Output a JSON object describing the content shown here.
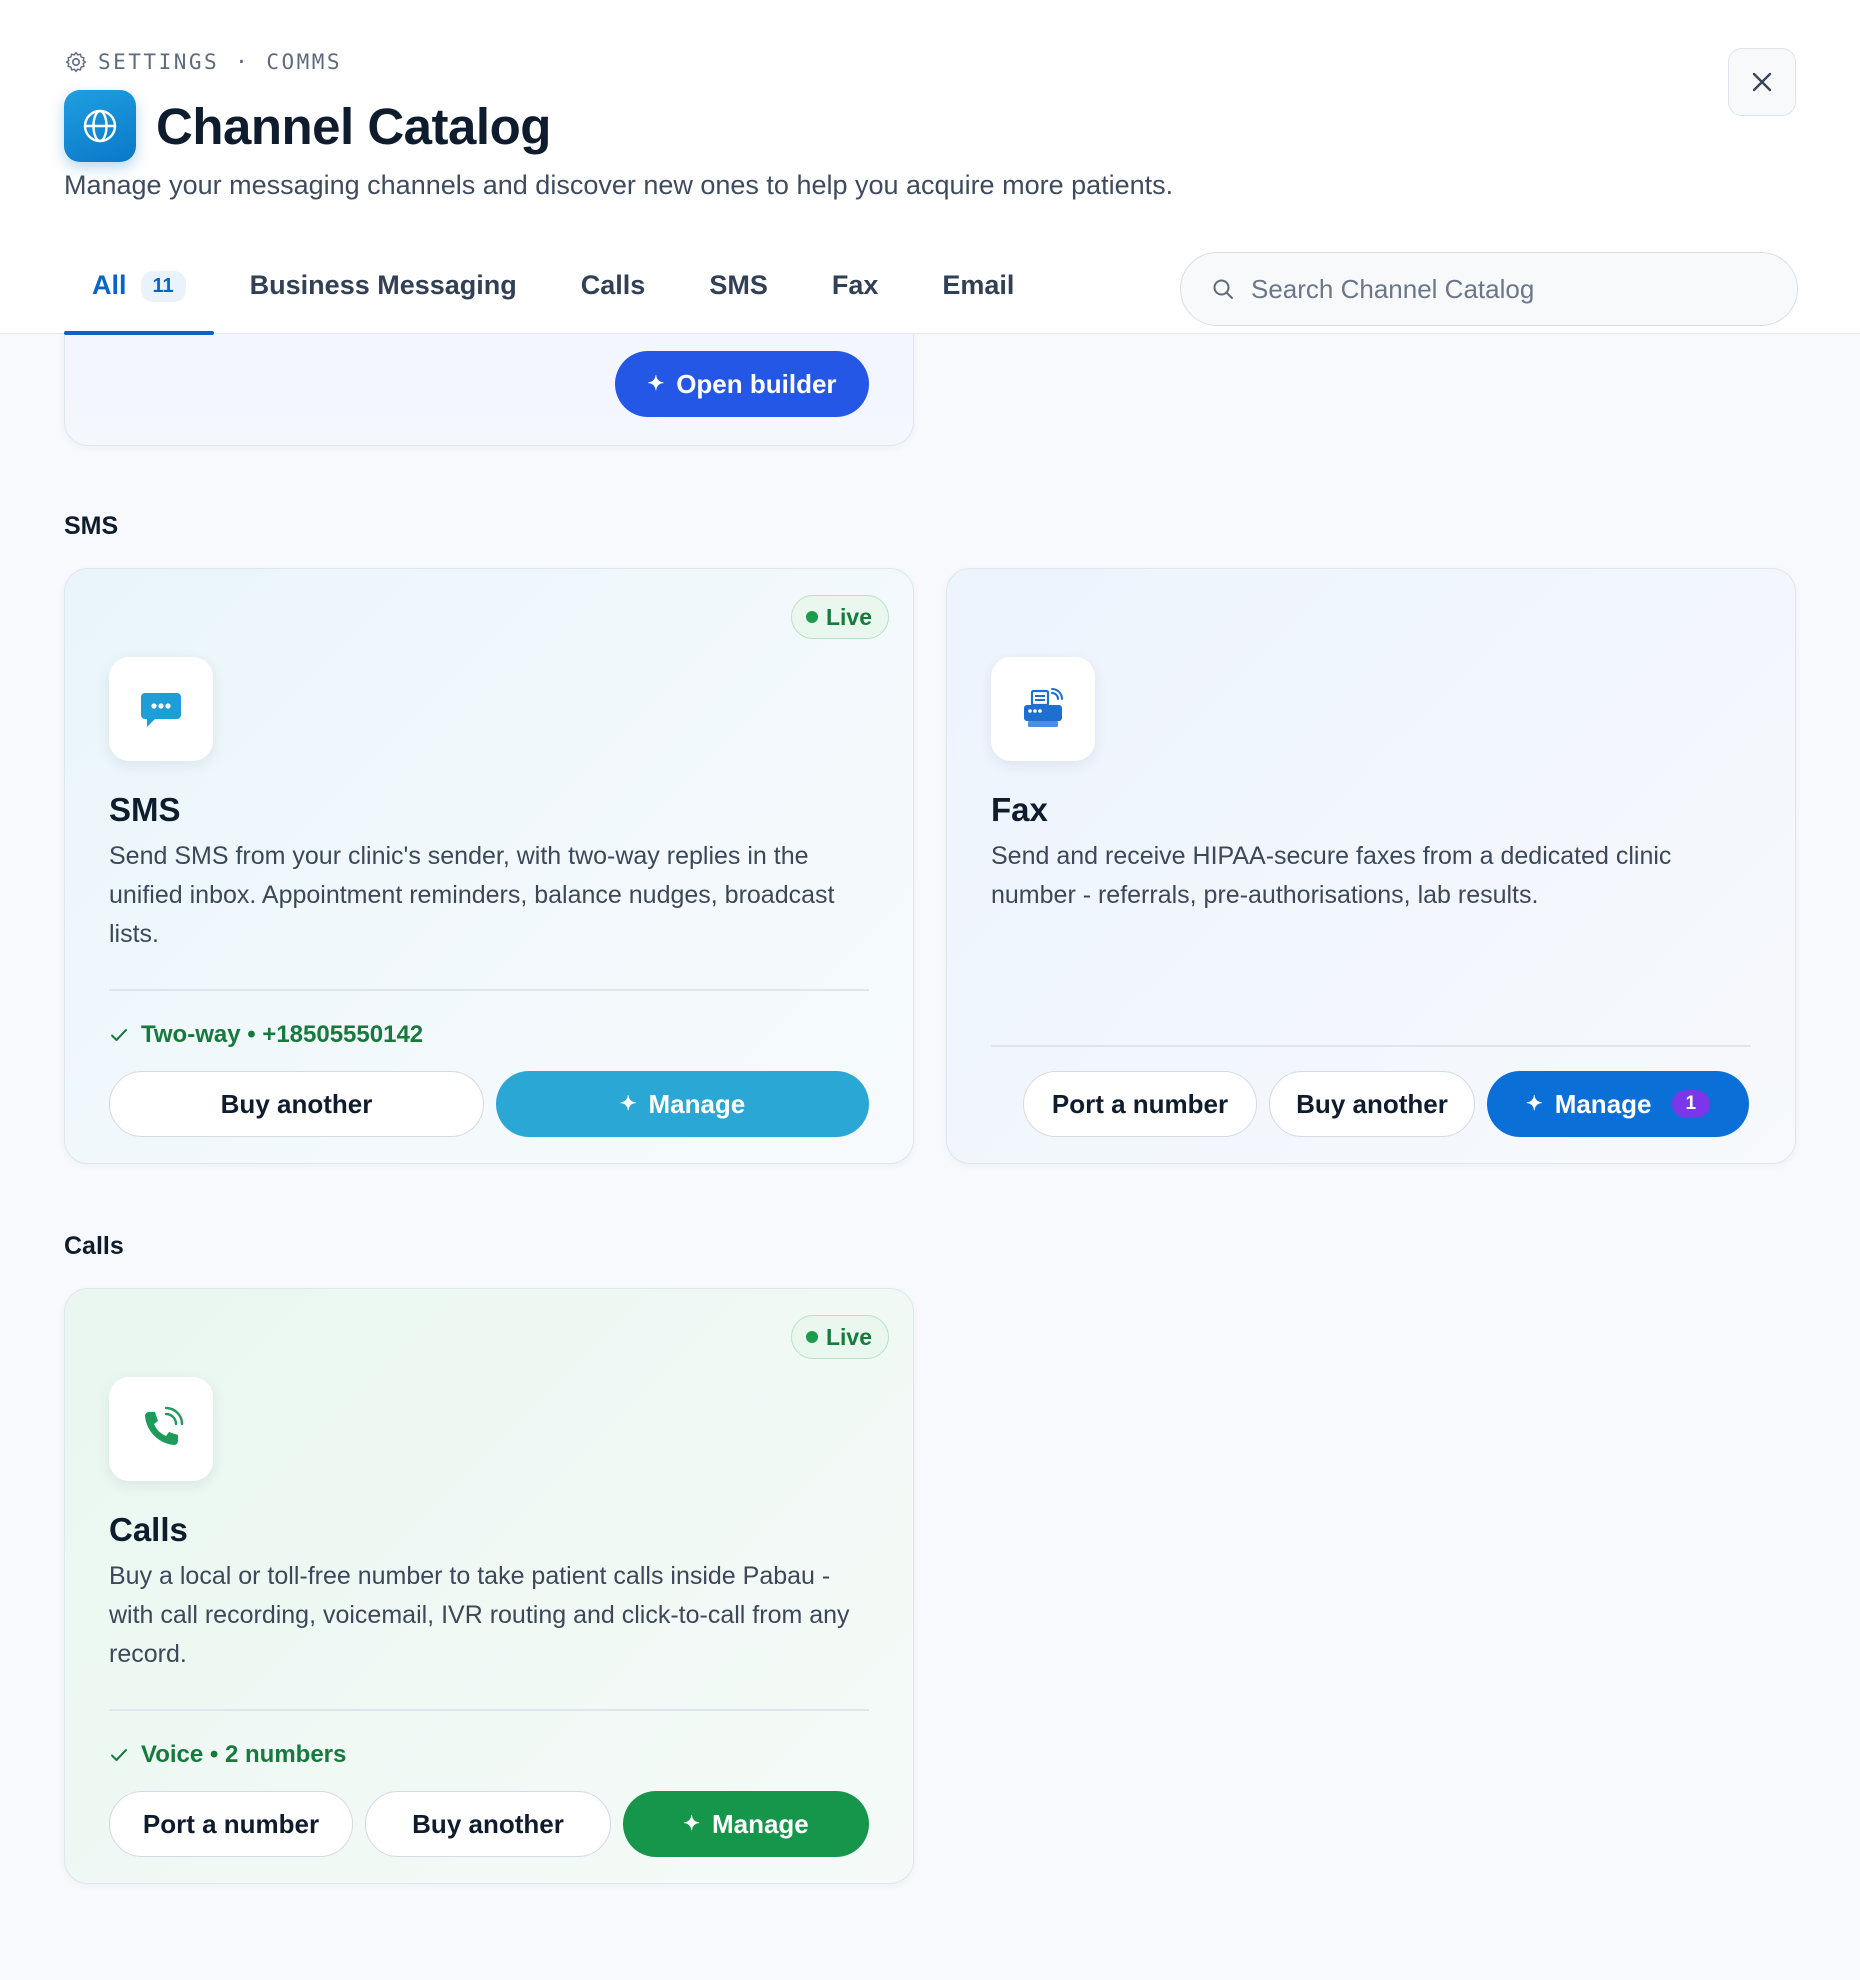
{
  "breadcrumb": {
    "settings": "SETTINGS",
    "separator": "·",
    "section": "COMMS"
  },
  "header": {
    "title": "Channel Catalog",
    "subtitle": "Manage your messaging channels and discover new ones to help you acquire more patients.",
    "icon": "globe-icon"
  },
  "tabs": [
    {
      "label": "All",
      "count": "11",
      "active": true
    },
    {
      "label": "Business Messaging"
    },
    {
      "label": "Calls"
    },
    {
      "label": "SMS"
    },
    {
      "label": "Fax"
    },
    {
      "label": "Email"
    }
  ],
  "search": {
    "placeholder": "Search Channel Catalog"
  },
  "builder_card": {
    "button_label": "Open builder",
    "button_color": "#2457e6"
  },
  "sections": {
    "sms": "SMS",
    "calls": "Calls"
  },
  "cards": {
    "sms": {
      "badge": "Live",
      "title": "SMS",
      "description": "Send SMS from your clinic's sender, with two-way replies in the unified inbox. Appointment reminders, balance nudges, broadcast lists.",
      "status": "Two-way • +18505550142",
      "buy_label": "Buy another",
      "manage_label": "Manage",
      "manage_color": "#2aa7d4",
      "icon": "chat-bubble-icon"
    },
    "fax": {
      "title": "Fax",
      "description": "Send and receive HIPAA-secure faxes from a dedicated clinic number - referrals, pre-authorisations, lab results.",
      "port_label": "Port a number",
      "buy_label": "Buy another",
      "manage_label": "Manage",
      "manage_count": "1",
      "manage_color": "#0a6fd6",
      "icon": "fax-machine-icon"
    },
    "calls": {
      "badge": "Live",
      "title": "Calls",
      "description": "Buy a local or toll-free number to take patient calls inside Pabau - with call recording, voicemail, IVR routing and click-to-call from any record.",
      "status": "Voice • 2 numbers",
      "port_label": "Port a number",
      "buy_label": "Buy another",
      "manage_label": "Manage",
      "manage_color": "#16964a",
      "icon": "phone-call-icon"
    }
  }
}
